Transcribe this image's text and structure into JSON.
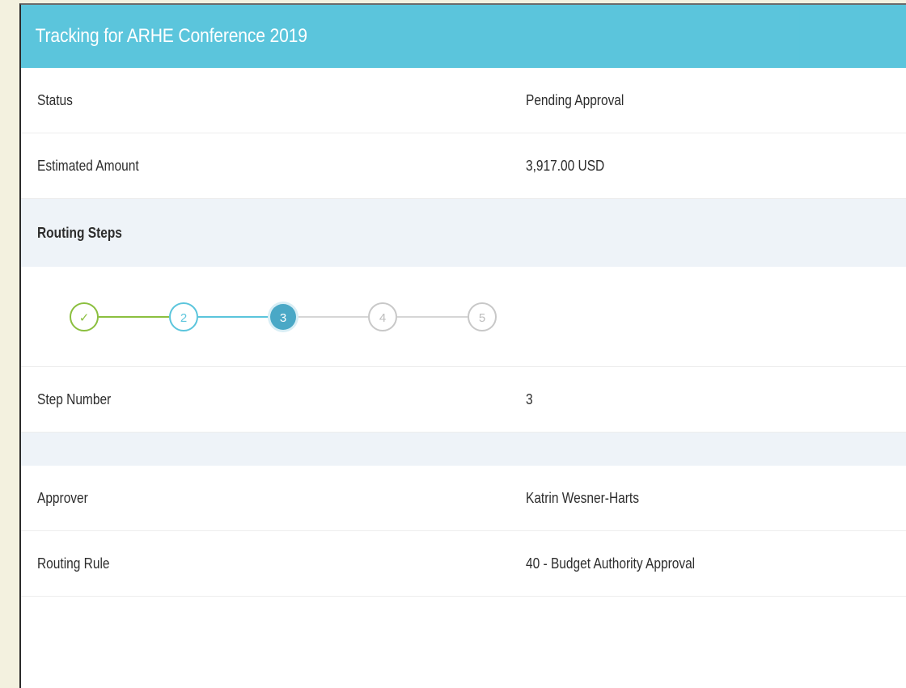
{
  "header": {
    "title": "Tracking for ARHE Conference 2019"
  },
  "details": [
    {
      "label": "Status",
      "value": "Pending Approval"
    },
    {
      "label": "Estimated Amount",
      "value": "3,917.00 USD"
    }
  ],
  "routing": {
    "section_title": "Routing Steps",
    "steps": [
      {
        "label": "✓",
        "state": "completed"
      },
      {
        "label": "2",
        "state": "active-outline"
      },
      {
        "label": "3",
        "state": "current"
      },
      {
        "label": "4",
        "state": "pending"
      },
      {
        "label": "5",
        "state": "pending"
      }
    ]
  },
  "step_details": [
    {
      "label": "Step Number",
      "value": "3"
    }
  ],
  "approver_details": [
    {
      "label": "Approver",
      "value": "Katrin Wesner-Harts"
    },
    {
      "label": "Routing Rule",
      "value": "40 - Budget Authority Approval"
    }
  ],
  "colors": {
    "header": "#5bc5dc",
    "completed": "#8bbf3f",
    "active": "#5bc5dc",
    "current_fill": "#4aa8c6",
    "pending": "#c8c8c8"
  }
}
